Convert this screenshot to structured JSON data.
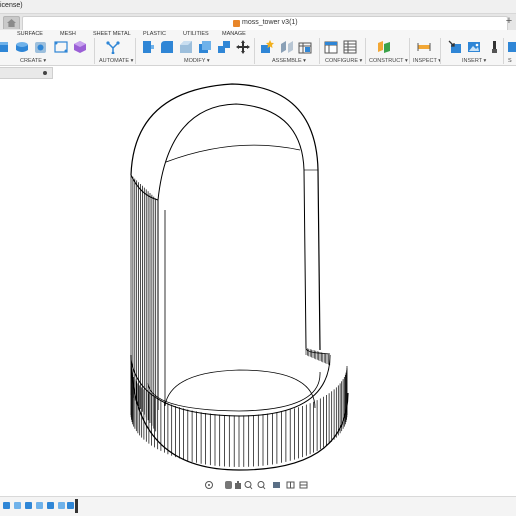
{
  "window": {
    "title_fragment": "icense)"
  },
  "tabs": {
    "document_title": "moss_tower v3(1)",
    "plus_label": "+"
  },
  "ribbon": {
    "top_tabs": [
      "SURFACE",
      "MESH",
      "SHEET METAL",
      "PLASTIC",
      "UTILITIES",
      "MANAGE"
    ],
    "groups": {
      "create": "CREATE ▾",
      "automate": "AUTOMATE ▾",
      "modify": "MODIFY ▾",
      "assemble": "ASSEMBLE ▾",
      "configure": "CONFIGURE ▾",
      "construct": "CONSTRUCT ▾",
      "inspect": "INSPECT ▾",
      "insert": "INSERT ▾",
      "select": "S"
    }
  },
  "icons": {
    "home": "home-icon",
    "browser_options": "dot-icon"
  },
  "colors": {
    "accent_blue": "#2f86d6",
    "construct_green": "#3aa24a",
    "document_orange": "#e8862a",
    "assemble_purple": "#8c62c8",
    "model_outline": "#000000"
  }
}
